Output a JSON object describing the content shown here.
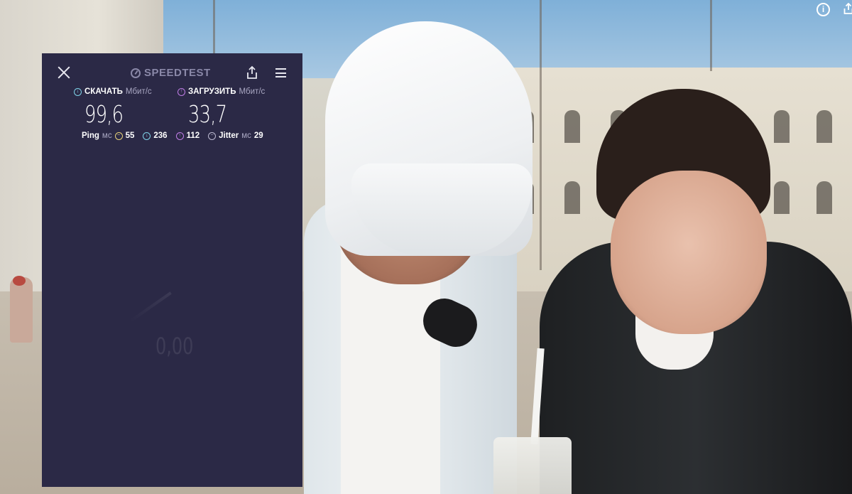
{
  "panel": {
    "brand": "SPEEDTEST",
    "download": {
      "label": "СКАЧАТЬ",
      "unit": "Мбит/с",
      "value": "99,6"
    },
    "upload": {
      "label": "ЗАГРУЗИТЬ",
      "unit": "Мбит/с",
      "value": "33,7"
    },
    "ping": {
      "label": "Ping",
      "unit": "мс",
      "idle": "55",
      "download": "236",
      "upload": "112"
    },
    "jitter": {
      "label": "Jitter",
      "unit": "мс",
      "value": "29"
    },
    "gauge_value": "0,00"
  },
  "colors": {
    "panel_bg": "#2b2946",
    "download_accent": "#7fd3e8",
    "upload_accent": "#c27ee8",
    "idle_accent": "#e7d17a"
  },
  "icons": [
    "close-icon",
    "speedtest-logo-icon",
    "share-icon",
    "menu-icon",
    "info-icon"
  ]
}
